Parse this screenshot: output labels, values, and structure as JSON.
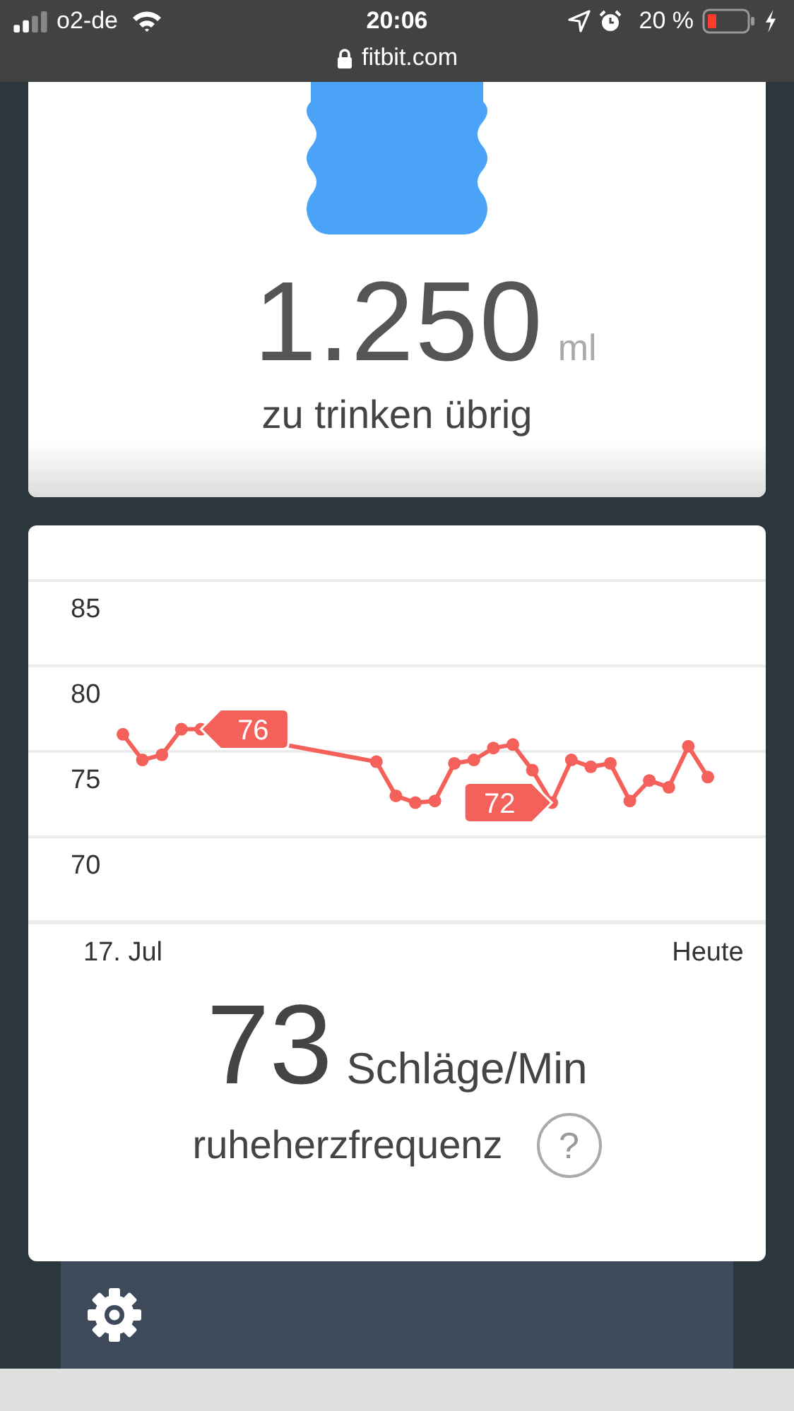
{
  "status_bar": {
    "carrier": "o2-de",
    "time": "20:06",
    "battery": "20 %",
    "url": "fitbit.com"
  },
  "water_card": {
    "amount": "1.250",
    "unit": "ml",
    "caption": "zu trinken übrig"
  },
  "heart_card": {
    "chart_data": {
      "type": "line",
      "categories": [
        "17. Jul",
        null,
        null,
        null,
        null,
        null,
        null,
        null,
        null,
        null,
        null,
        null,
        null,
        null,
        null,
        null,
        null,
        null,
        null,
        null,
        null,
        null,
        null,
        null,
        null,
        null,
        null,
        null,
        null,
        null,
        "Heute"
      ],
      "grid": true,
      "series": [
        {
          "color": "#f4605a",
          "marker": "circle",
          "values": [
            76,
            74.5,
            74.8,
            76.3,
            76.3,
            null,
            null,
            null,
            null,
            null,
            null,
            null,
            null,
            74.4,
            72.4,
            72,
            72.1,
            74.3,
            74.5,
            75.2,
            75.4,
            73.9,
            72,
            74.5,
            74.1,
            74.3,
            72.1,
            73.3,
            72.9,
            75.3,
            73.5
          ]
        }
      ],
      "ylim": [
        65,
        85
      ],
      "yticks": [
        70,
        75,
        80,
        85
      ],
      "annotations": [
        "76",
        "72"
      ]
    },
    "value": "73",
    "unit": "Schläge/Min",
    "caption": "ruheherzfrequenz",
    "help": "?"
  }
}
